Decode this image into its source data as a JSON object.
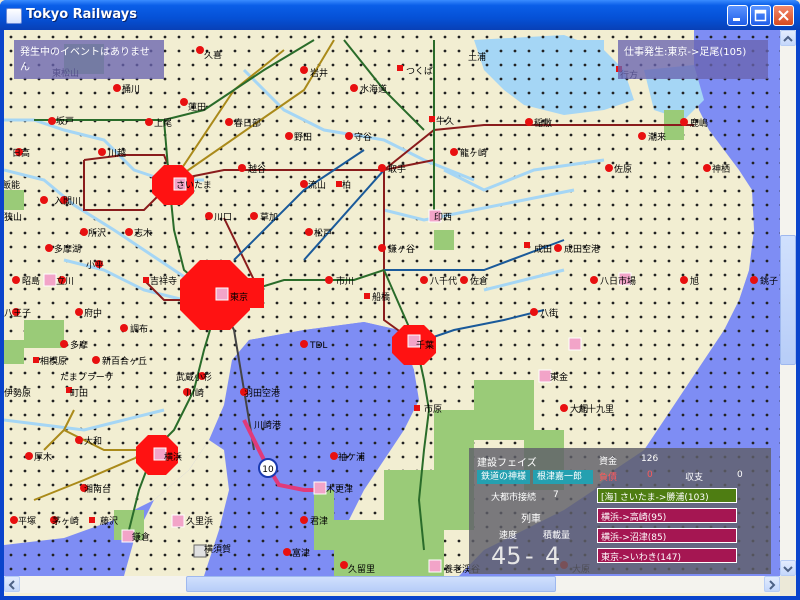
{
  "window": {
    "title": "Tokyo Railways"
  },
  "overlay": {
    "event_text": "発生中のイベントはありません",
    "job_text": "仕事発生:東京->足尾(105)"
  },
  "panel": {
    "phase": "建設フェイズ",
    "funds_label": "資金",
    "funds_value": "126",
    "card_name": "鉄道の神様",
    "card_detail": "根津嘉一郎",
    "debt_label": "負債",
    "debt_value": "0",
    "income_label": "収支",
    "income_value": "0",
    "metro_label": "大都市接続",
    "metro_value": "7",
    "train_label": "列車",
    "speed_label": "速度",
    "cap_label": "積載量",
    "speed_value": "45",
    "cap_value": "4",
    "routes": [
      {
        "text": "[海] さいたま->勝浦(103)",
        "color": "#4e7d12"
      },
      {
        "text": "横浜->高崎(95)",
        "color": "#a51652"
      },
      {
        "text": "横浜->沼津(85)",
        "color": "#a51652"
      },
      {
        "text": "東京->いわき(147)",
        "color": "#a51652"
      }
    ]
  },
  "train": {
    "number": "10"
  },
  "stations": [
    {
      "name": "久喜"
    },
    {
      "name": "岩井"
    },
    {
      "name": "つくば"
    },
    {
      "name": "土浦"
    },
    {
      "name": "東松山"
    },
    {
      "name": "桶川"
    },
    {
      "name": "水海道"
    },
    {
      "name": "行方"
    },
    {
      "name": "坂戸"
    },
    {
      "name": "上尾"
    },
    {
      "name": "蓮田"
    },
    {
      "name": "春日部"
    },
    {
      "name": "守谷"
    },
    {
      "name": "牛久"
    },
    {
      "name": "稲敷"
    },
    {
      "name": "鹿嶋"
    },
    {
      "name": "日高"
    },
    {
      "name": "川越"
    },
    {
      "name": "野田"
    },
    {
      "name": "潮来"
    },
    {
      "name": "越谷"
    },
    {
      "name": "取手"
    },
    {
      "name": "龍ヶ崎"
    },
    {
      "name": "佐原"
    },
    {
      "name": "神栖"
    },
    {
      "name": "飯能"
    },
    {
      "name": "さいたま"
    },
    {
      "name": "流山"
    },
    {
      "name": "柏"
    },
    {
      "name": "入間川"
    },
    {
      "name": "川口"
    },
    {
      "name": "草加"
    },
    {
      "name": "印西"
    },
    {
      "name": "狭山"
    },
    {
      "name": "所沢"
    },
    {
      "name": "志木"
    },
    {
      "name": "松戸"
    },
    {
      "name": "鎌ヶ谷"
    },
    {
      "name": "成田"
    },
    {
      "name": "成田空港"
    },
    {
      "name": "多摩湖"
    },
    {
      "name": "小平"
    },
    {
      "name": "昭島"
    },
    {
      "name": "立川"
    },
    {
      "name": "吉祥寺"
    },
    {
      "name": "東京"
    },
    {
      "name": "市川"
    },
    {
      "name": "八千代"
    },
    {
      "name": "佐倉"
    },
    {
      "name": "八日市場"
    },
    {
      "name": "旭"
    },
    {
      "name": "銚子"
    },
    {
      "name": "船橋"
    },
    {
      "name": "八王子"
    },
    {
      "name": "府中"
    },
    {
      "name": "八街"
    },
    {
      "name": "調布"
    },
    {
      "name": "TDL"
    },
    {
      "name": "千葉"
    },
    {
      "name": "東金"
    },
    {
      "name": "多摩"
    },
    {
      "name": "相模原"
    },
    {
      "name": "新百合ヶ丘"
    },
    {
      "name": "たまプラーザ"
    },
    {
      "name": "武蔵小杉"
    },
    {
      "name": "大網"
    },
    {
      "name": "町田"
    },
    {
      "name": "羽田空港"
    },
    {
      "name": "川崎"
    },
    {
      "name": "市原"
    },
    {
      "name": "九十九里"
    },
    {
      "name": "伊勢原"
    },
    {
      "name": "大和"
    },
    {
      "name": "川崎港"
    },
    {
      "name": "厚木"
    },
    {
      "name": "横浜"
    },
    {
      "name": "袖ケ浦"
    },
    {
      "name": "湘南台"
    },
    {
      "name": "木更津"
    },
    {
      "name": "平塚"
    },
    {
      "name": "茅ヶ崎"
    },
    {
      "name": "藤沢"
    },
    {
      "name": "久里浜"
    },
    {
      "name": "君津"
    },
    {
      "name": "鎌倉"
    },
    {
      "name": "横須賀"
    },
    {
      "name": "富津"
    },
    {
      "name": "久留里"
    },
    {
      "name": "養老渓谷"
    },
    {
      "name": "大原"
    }
  ]
}
